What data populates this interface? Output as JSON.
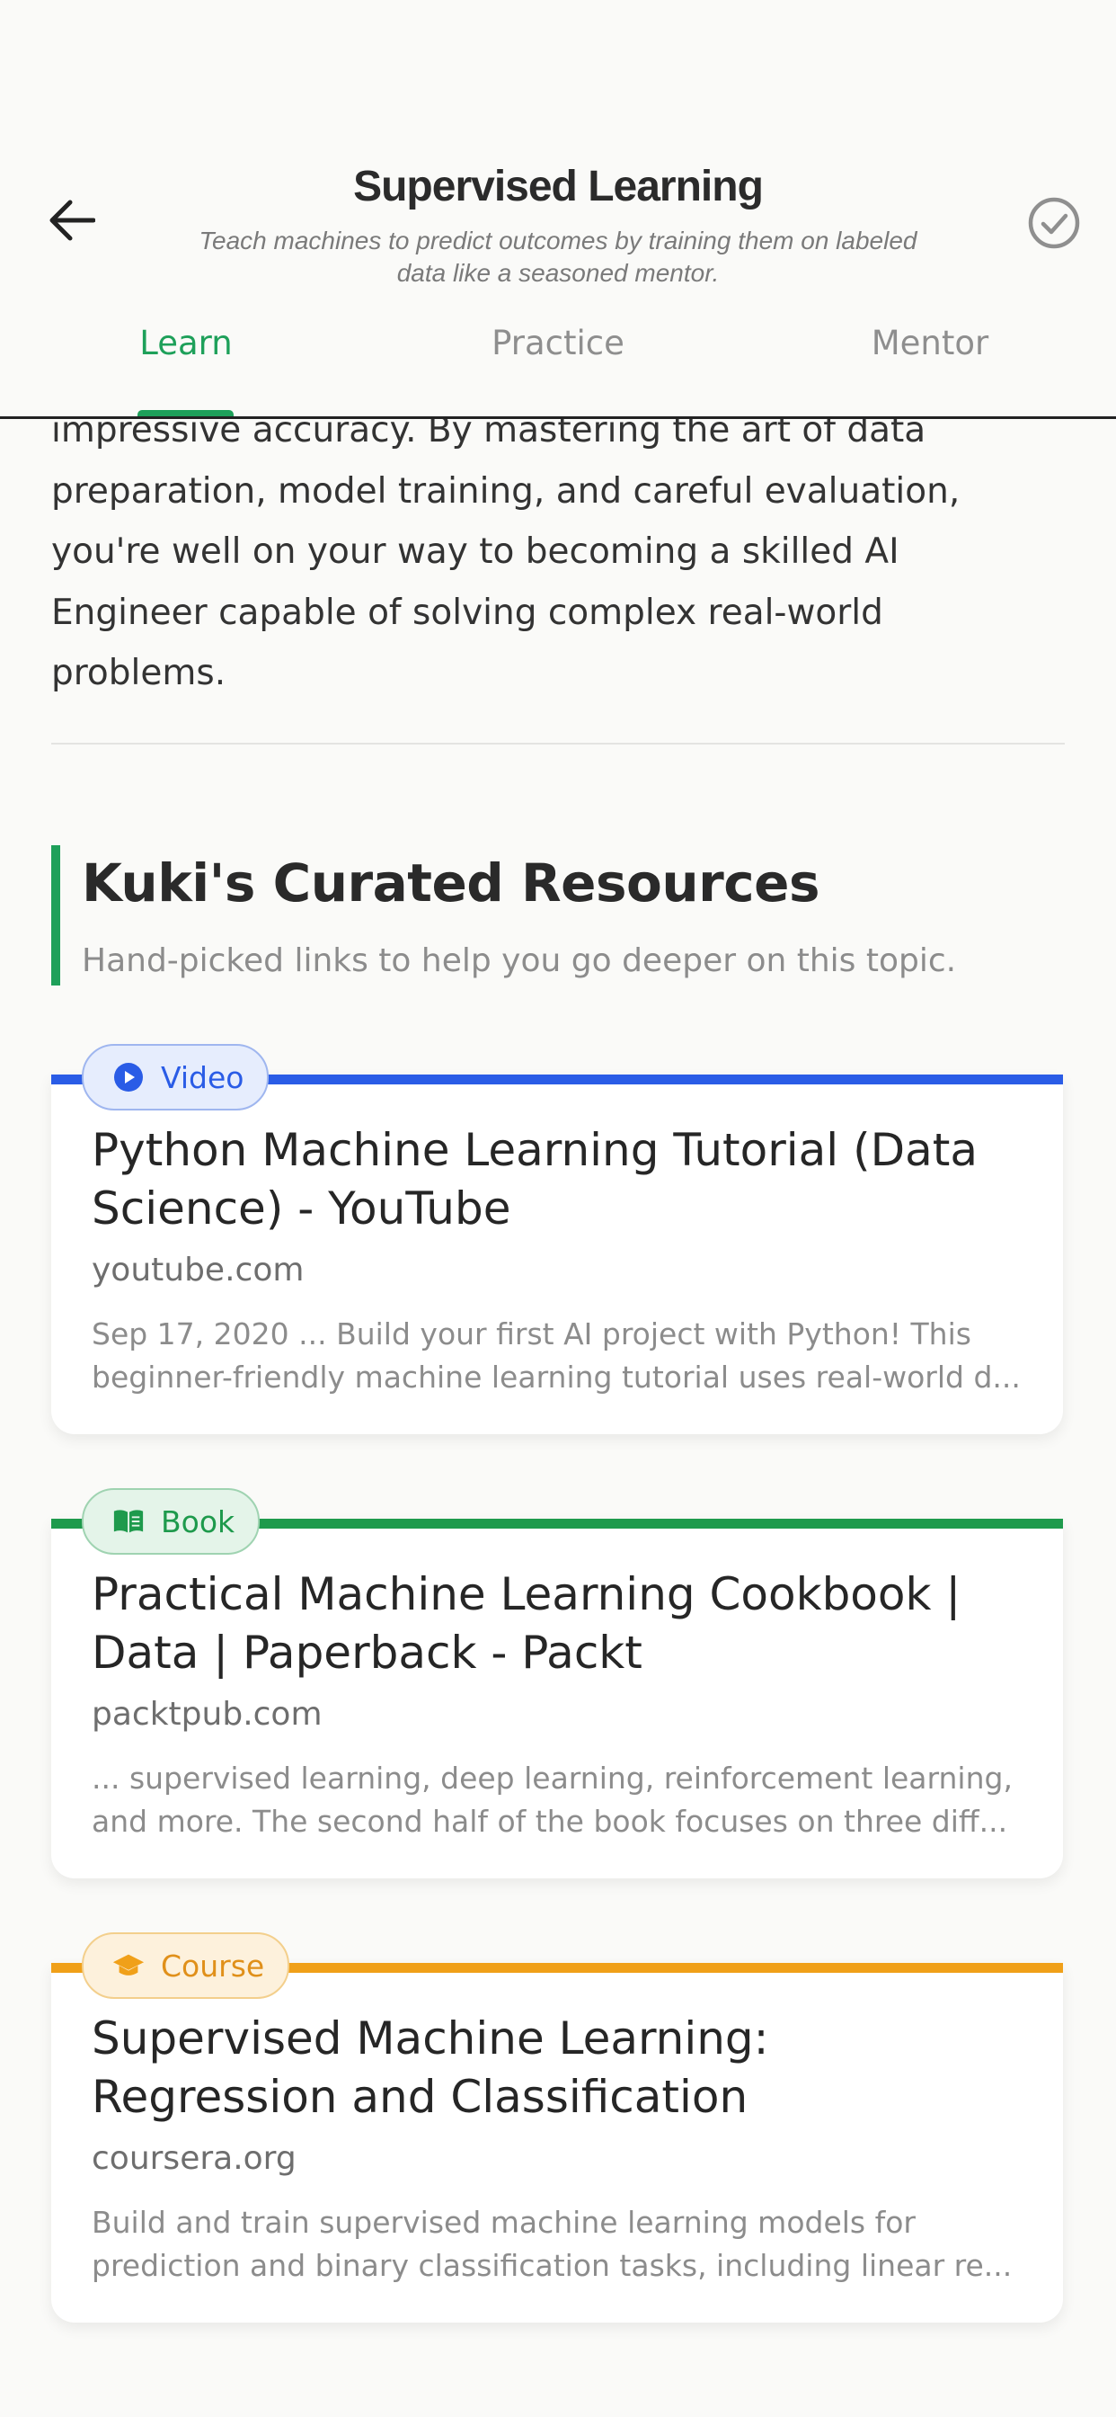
{
  "header": {
    "title": "Supervised Learning",
    "subtitle_line1": "Teach machines to predict outcomes by training them on labeled",
    "subtitle_line2": "data like a seasoned mentor.",
    "back_icon": "arrow-left-icon",
    "complete_icon": "check-circle-icon",
    "tabs": [
      {
        "label": "Learn",
        "active": true
      },
      {
        "label": "Practice",
        "active": false
      },
      {
        "label": "Mentor",
        "active": false
      }
    ],
    "accent_color": "#1ea05a"
  },
  "intro": {
    "lines": [
      "impressive accuracy. By mastering the art of data",
      "preparation, model training, and careful evaluation,",
      "you're well on your way to becoming a skilled AI",
      "Engineer capable of solving complex real-world",
      "problems."
    ]
  },
  "resources": {
    "title": "Kuki's Curated Resources",
    "subtitle": "Hand-picked links to help you go deeper on this topic.",
    "items": [
      {
        "type": "Video",
        "icon": "play-circle-icon",
        "color": "#2a5ce6",
        "title_line1": "Python Machine Learning Tutorial (Data",
        "title_line2": "Science) - YouTube",
        "domain": "youtube.com",
        "snippet_line1": "Sep 17, 2020 ... Build your first AI project with Python! This",
        "snippet_line2": "beginner-friendly machine learning tutorial uses real-world d..."
      },
      {
        "type": "Book",
        "icon": "book-open-icon",
        "color": "#1e9a4c",
        "title_line1": "Practical Machine Learning Cookbook |",
        "title_line2": "Data | Paperback - Packt",
        "domain": "packtpub.com",
        "snippet_line1": "... supervised learning, deep learning, reinforcement learning,",
        "snippet_line2": "and more. The second half of the book focuses on three diff..."
      },
      {
        "type": "Course",
        "icon": "graduation-cap-icon",
        "color": "#f0a019",
        "title_line1": "Supervised Machine Learning:",
        "title_line2": "Regression and Classification",
        "domain": "coursera.org",
        "snippet_line1": "Build and train supervised machine learning models for",
        "snippet_line2": "prediction and binary classification tasks, including linear re..."
      }
    ]
  }
}
